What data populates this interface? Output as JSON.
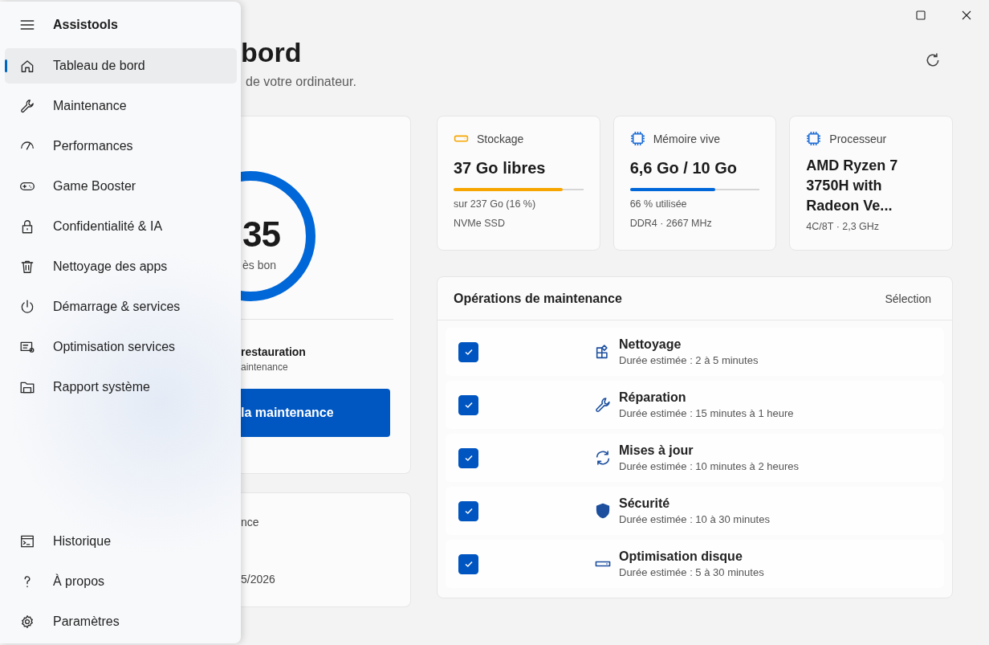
{
  "nav": {
    "app_title": "Assistools",
    "items": [
      {
        "label": "Tableau de bord",
        "selected": true
      },
      {
        "label": "Maintenance",
        "selected": false
      },
      {
        "label": "Performances",
        "selected": false
      },
      {
        "label": "Game Booster",
        "selected": false
      },
      {
        "label": "Confidentialité & IA",
        "selected": false
      },
      {
        "label": "Nettoyage des apps",
        "selected": false
      },
      {
        "label": "Démarrage & services",
        "selected": false
      },
      {
        "label": "Optimisation services",
        "selected": false
      },
      {
        "label": "Rapport système",
        "selected": false
      }
    ],
    "footer_items": [
      {
        "label": "Historique",
        "selected": false
      },
      {
        "label": "À propos",
        "selected": false
      },
      {
        "label": "Paramètres",
        "selected": false
      }
    ]
  },
  "header": {
    "title": "bord",
    "subtitle": "de votre ordinateur."
  },
  "score_card": {
    "score": "35",
    "score_label": "ès bon",
    "restore_title": "restauration",
    "restore_note": "aintenance",
    "action_button": "la maintenance"
  },
  "last_card": {
    "label": "nce",
    "date": "5/2026"
  },
  "stats": [
    {
      "kind": "storage",
      "label": "Stockage",
      "value": "37 Go libres",
      "level": 0.84,
      "color": "#f7a600",
      "details": [
        "sur 237 Go (16 %)",
        "NVMe SSD"
      ]
    },
    {
      "kind": "memory",
      "label": "Mémoire vive",
      "value": "6,6 Go / 10 Go",
      "level": 0.66,
      "color": "#0067d8",
      "details": [
        "66 % utilisée",
        "DDR4 · 2667 MHz"
      ]
    },
    {
      "kind": "cpu",
      "label": "Processeur",
      "value": "AMD Ryzen 7 3750H with Radeon Ve...",
      "details": [
        "4C/8T · 2,3 GHz"
      ]
    }
  ],
  "operations": {
    "title": "Opérations de maintenance",
    "action": "Sélection",
    "items": [
      {
        "title": "Nettoyage",
        "duration": "Durée estimée : 2 à 5 minutes",
        "checked": true
      },
      {
        "title": "Réparation",
        "duration": "Durée estimée : 15 minutes à 1 heure",
        "checked": true
      },
      {
        "title": "Mises à jour",
        "duration": "Durée estimée : 10 minutes à 2 heures",
        "checked": true
      },
      {
        "title": "Sécurité",
        "duration": "Durée estimée : 10 à 30 minutes",
        "checked": true
      },
      {
        "title": "Optimisation disque",
        "duration": "Durée estimée : 5 à 30 minutes",
        "checked": true
      }
    ]
  }
}
